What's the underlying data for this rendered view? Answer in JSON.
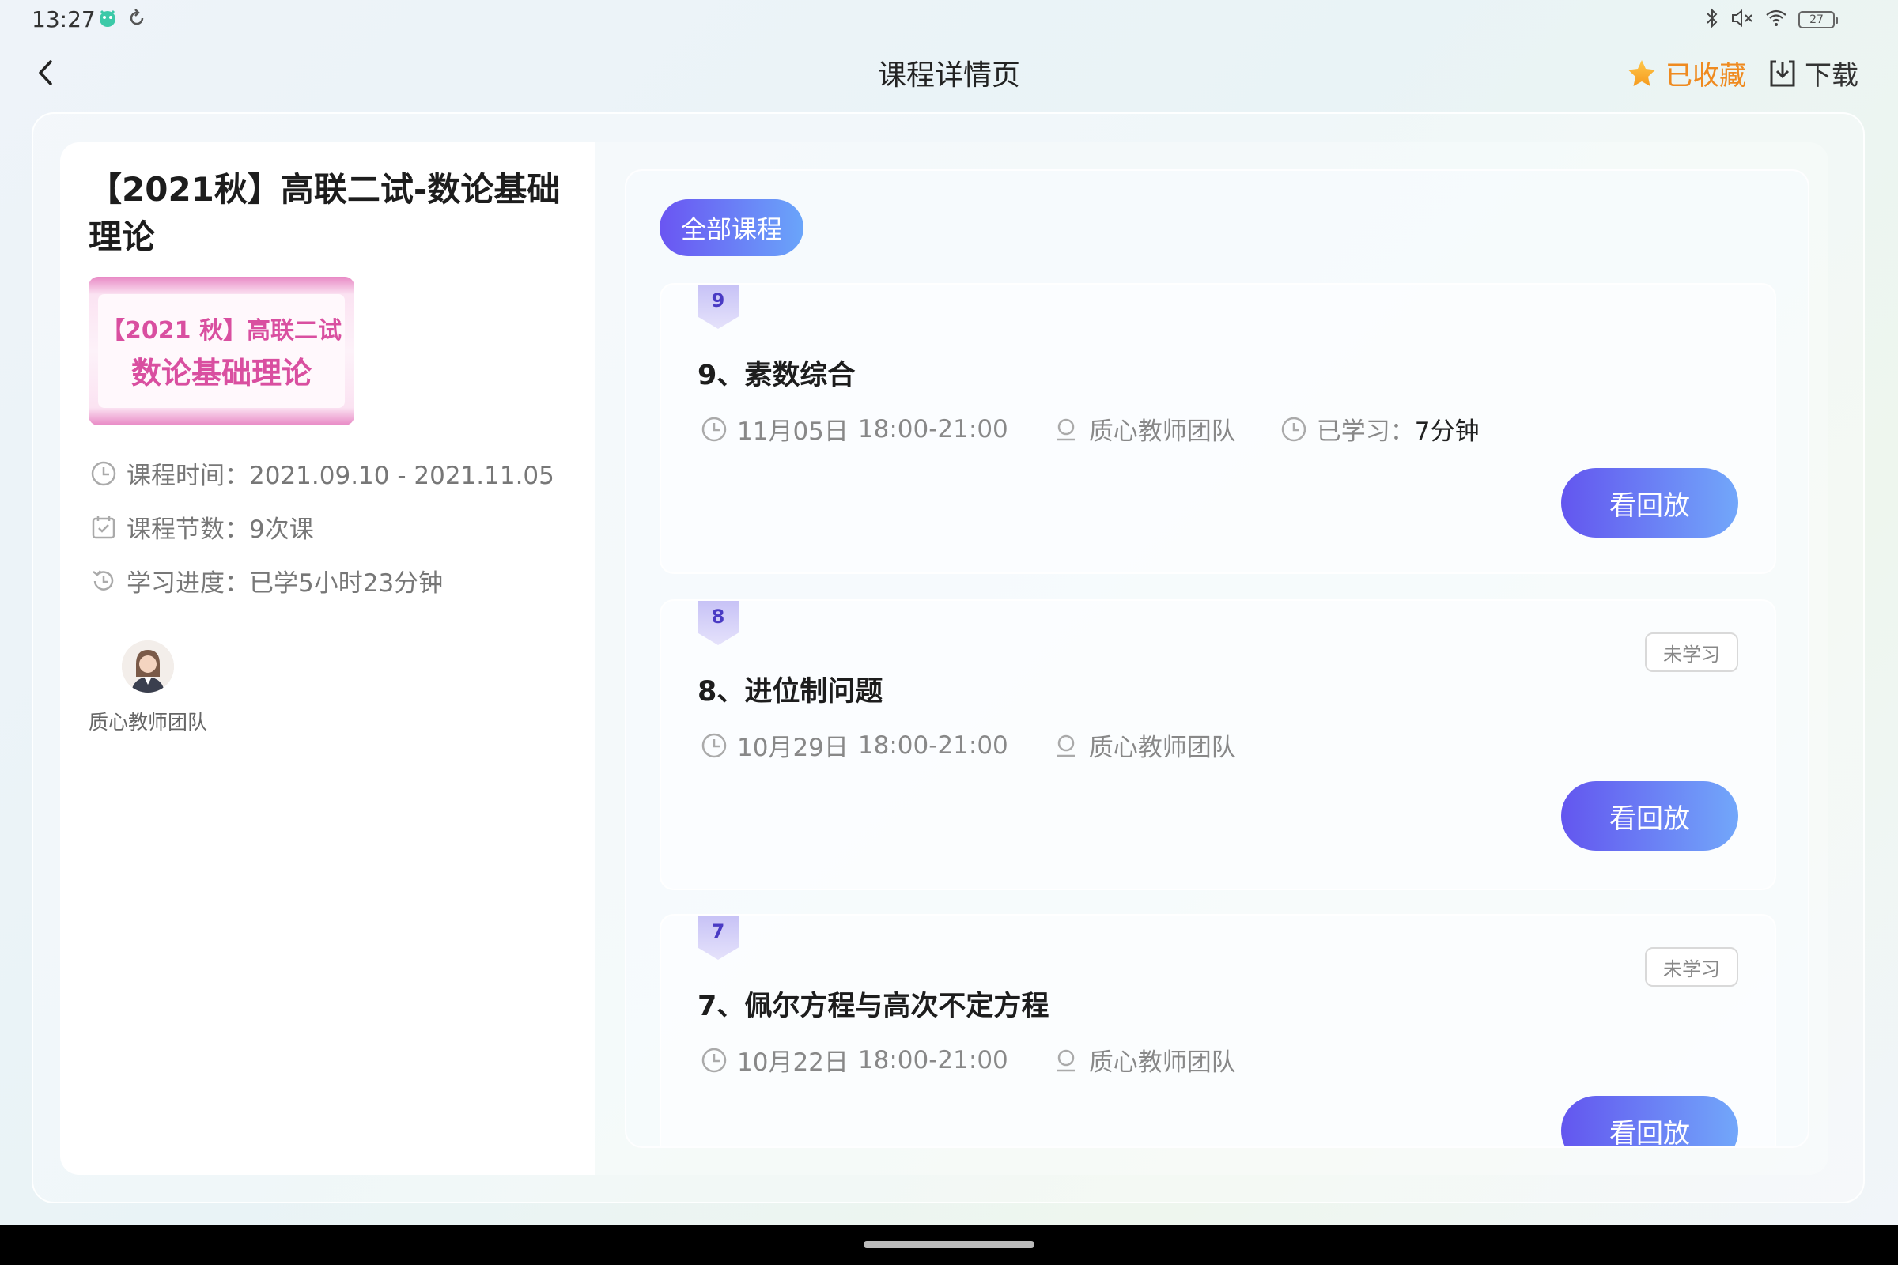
{
  "status_bar": {
    "time": "13:27",
    "battery": "27"
  },
  "header": {
    "title": "课程详情页",
    "favorite_label": "已收藏",
    "download_label": "下载"
  },
  "course": {
    "title": "【2021秋】高联二试-数论基础理论",
    "cover_line1": "【2021 秋】高联二试",
    "cover_line2": "数论基础理论",
    "time_label": "课程时间：",
    "time_value": "2021.09.10 - 2021.11.05",
    "sessions_label": "课程节数：",
    "sessions_value": "9次课",
    "progress_label": "学习进度：",
    "progress_value": "已学5小时23分钟",
    "teacher": "质心教师团队"
  },
  "tabs": {
    "all": "全部课程"
  },
  "lessons": [
    {
      "number": "9",
      "title": "9、素数综合",
      "date": "11月05日",
      "time": "18:00-21:00",
      "teacher": "质心教师团队",
      "studied_label": "已学习：",
      "studied_value": "7分钟",
      "status": "",
      "button": "看回放"
    },
    {
      "number": "8",
      "title": "8、进位制问题",
      "date": "10月29日",
      "time": "18:00-21:00",
      "teacher": "质心教师团队",
      "status": "未学习",
      "button": "看回放"
    },
    {
      "number": "7",
      "title": "7、佩尔方程与高次不定方程",
      "date": "10月22日",
      "time": "18:00-21:00",
      "teacher": "质心教师团队",
      "status": "未学习",
      "button": "看回放"
    }
  ],
  "colors": {
    "accent_gradient_start": "#6356ef",
    "accent_gradient_end": "#72a7fa",
    "favorite": "#ef8a1f",
    "badge_text": "#4a3bc4"
  }
}
